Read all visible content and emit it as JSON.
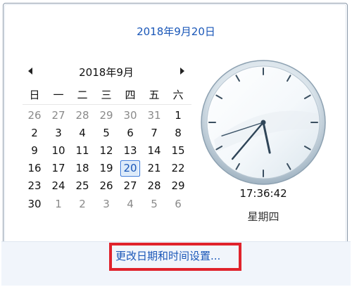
{
  "header": {
    "date_long": "2018年9月20日"
  },
  "calendar": {
    "month_title": "2018年9月",
    "weekdays": [
      "日",
      "一",
      "二",
      "三",
      "四",
      "五",
      "六"
    ],
    "days": [
      {
        "d": "26",
        "other": true
      },
      {
        "d": "27",
        "other": true
      },
      {
        "d": "28",
        "other": true
      },
      {
        "d": "29",
        "other": true
      },
      {
        "d": "30",
        "other": true
      },
      {
        "d": "31",
        "other": true
      },
      {
        "d": "1",
        "other": false
      },
      {
        "d": "2",
        "other": false
      },
      {
        "d": "3",
        "other": false
      },
      {
        "d": "4",
        "other": false
      },
      {
        "d": "5",
        "other": false
      },
      {
        "d": "6",
        "other": false
      },
      {
        "d": "7",
        "other": false
      },
      {
        "d": "8",
        "other": false
      },
      {
        "d": "9",
        "other": false
      },
      {
        "d": "10",
        "other": false
      },
      {
        "d": "11",
        "other": false
      },
      {
        "d": "12",
        "other": false
      },
      {
        "d": "13",
        "other": false
      },
      {
        "d": "14",
        "other": false
      },
      {
        "d": "15",
        "other": false
      },
      {
        "d": "16",
        "other": false
      },
      {
        "d": "17",
        "other": false
      },
      {
        "d": "18",
        "other": false
      },
      {
        "d": "19",
        "other": false
      },
      {
        "d": "20",
        "other": false,
        "selected": true
      },
      {
        "d": "21",
        "other": false
      },
      {
        "d": "22",
        "other": false
      },
      {
        "d": "23",
        "other": false
      },
      {
        "d": "24",
        "other": false
      },
      {
        "d": "25",
        "other": false
      },
      {
        "d": "26",
        "other": false
      },
      {
        "d": "27",
        "other": false
      },
      {
        "d": "28",
        "other": false
      },
      {
        "d": "29",
        "other": false
      },
      {
        "d": "30",
        "other": false
      },
      {
        "d": "1",
        "other": true
      },
      {
        "d": "2",
        "other": true
      },
      {
        "d": "3",
        "other": true
      },
      {
        "d": "4",
        "other": true
      },
      {
        "d": "5",
        "other": true
      },
      {
        "d": "6",
        "other": true
      }
    ]
  },
  "clock": {
    "time": "17:36:42",
    "weekday": "星期四",
    "hour": 17,
    "minute": 36,
    "second": 42
  },
  "footer": {
    "link_label": "更改日期和时间设置..."
  },
  "colors": {
    "link": "#1a57b8",
    "highlight": "#e0232c",
    "selection": "#2a6fd6"
  }
}
